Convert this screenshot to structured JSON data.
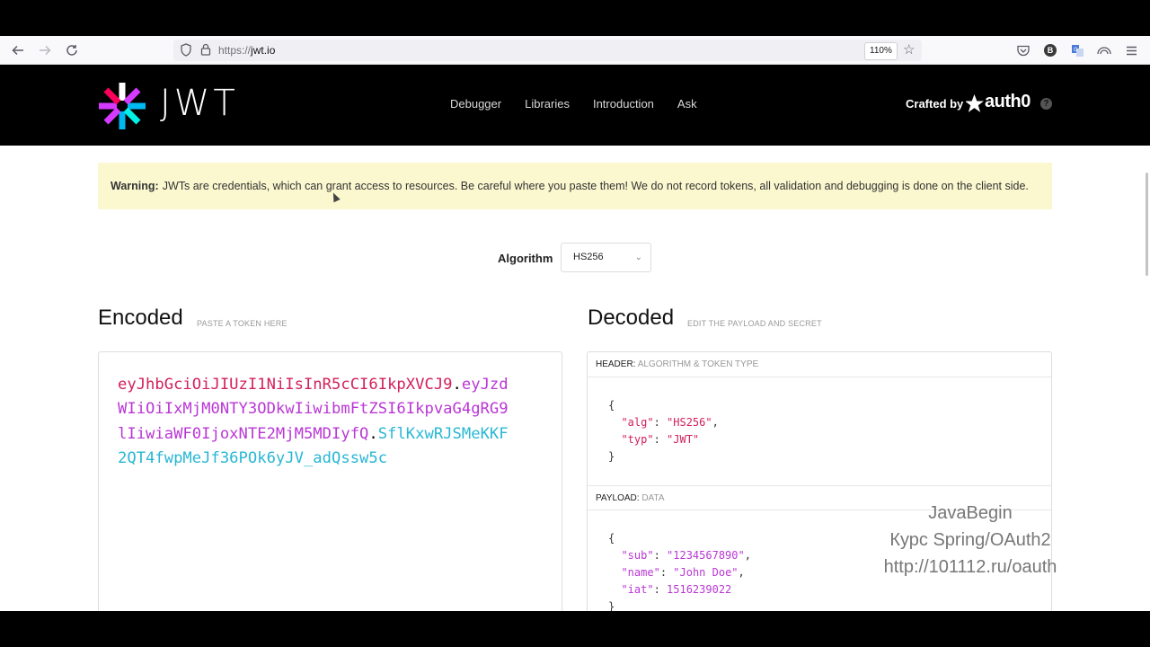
{
  "browser": {
    "url_protocol": "https://",
    "url_host": "jwt.io",
    "zoom": "110%",
    "icons": [
      "back-arrow-icon",
      "forward-arrow-icon",
      "reload-icon",
      "shield-icon",
      "lock-icon",
      "star-icon",
      "pocket-icon",
      "account-icon",
      "translate-icon",
      "extension-icon",
      "menu-icon"
    ],
    "account_initial": "B"
  },
  "header": {
    "logo_text": "JWT",
    "nav": [
      "Debugger",
      "Libraries",
      "Introduction",
      "Ask"
    ],
    "crafted_by": "Crafted by",
    "brand": "auth0",
    "help": "?"
  },
  "warning": {
    "strong": "Warning:",
    "text": "JWTs are credentials, which can grant access to resources. Be careful where you paste them! We do not record tokens, all validation and debugging is done on the client side."
  },
  "algorithm": {
    "label": "Algorithm",
    "value": "HS256"
  },
  "encoded": {
    "title": "Encoded",
    "subtitle": "PASTE A TOKEN HERE",
    "token_header": "eyJhbGciOiJIUzI1NiIsInR5cCI6IkpXVCJ9",
    "token_payload": "eyJzdWIiOiIxMjM0NTY3ODkwIiwibmFtZSI6IkpvaG4gRG9lIiwiaWF0IjoxNTE2MjM5MDIyfQ",
    "token_signature": "SflKxwRJSMeKKF2QT4fwpMeJf36POk6yJV_adQssw5c",
    "dot": "."
  },
  "decoded": {
    "title": "Decoded",
    "subtitle": "EDIT THE PAYLOAD AND SECRET",
    "header_label": "HEADER:",
    "header_sub": "ALGORITHM & TOKEN TYPE",
    "header_json": {
      "alg_key": "\"alg\"",
      "alg_val": "\"HS256\"",
      "typ_key": "\"typ\"",
      "typ_val": "\"JWT\""
    },
    "payload_label": "PAYLOAD:",
    "payload_sub": "DATA",
    "payload_json": {
      "sub_key": "\"sub\"",
      "sub_val": "\"1234567890\"",
      "name_key": "\"name\"",
      "name_val": "\"John Doe\"",
      "iat_key": "\"iat\"",
      "iat_val": "1516239022"
    },
    "open_brace": "{",
    "close_brace": "}"
  },
  "watermark": {
    "line1": "JavaBegin",
    "line2": "Курс Spring/OAuth2",
    "line3": "http://101112.ru/oauth"
  }
}
